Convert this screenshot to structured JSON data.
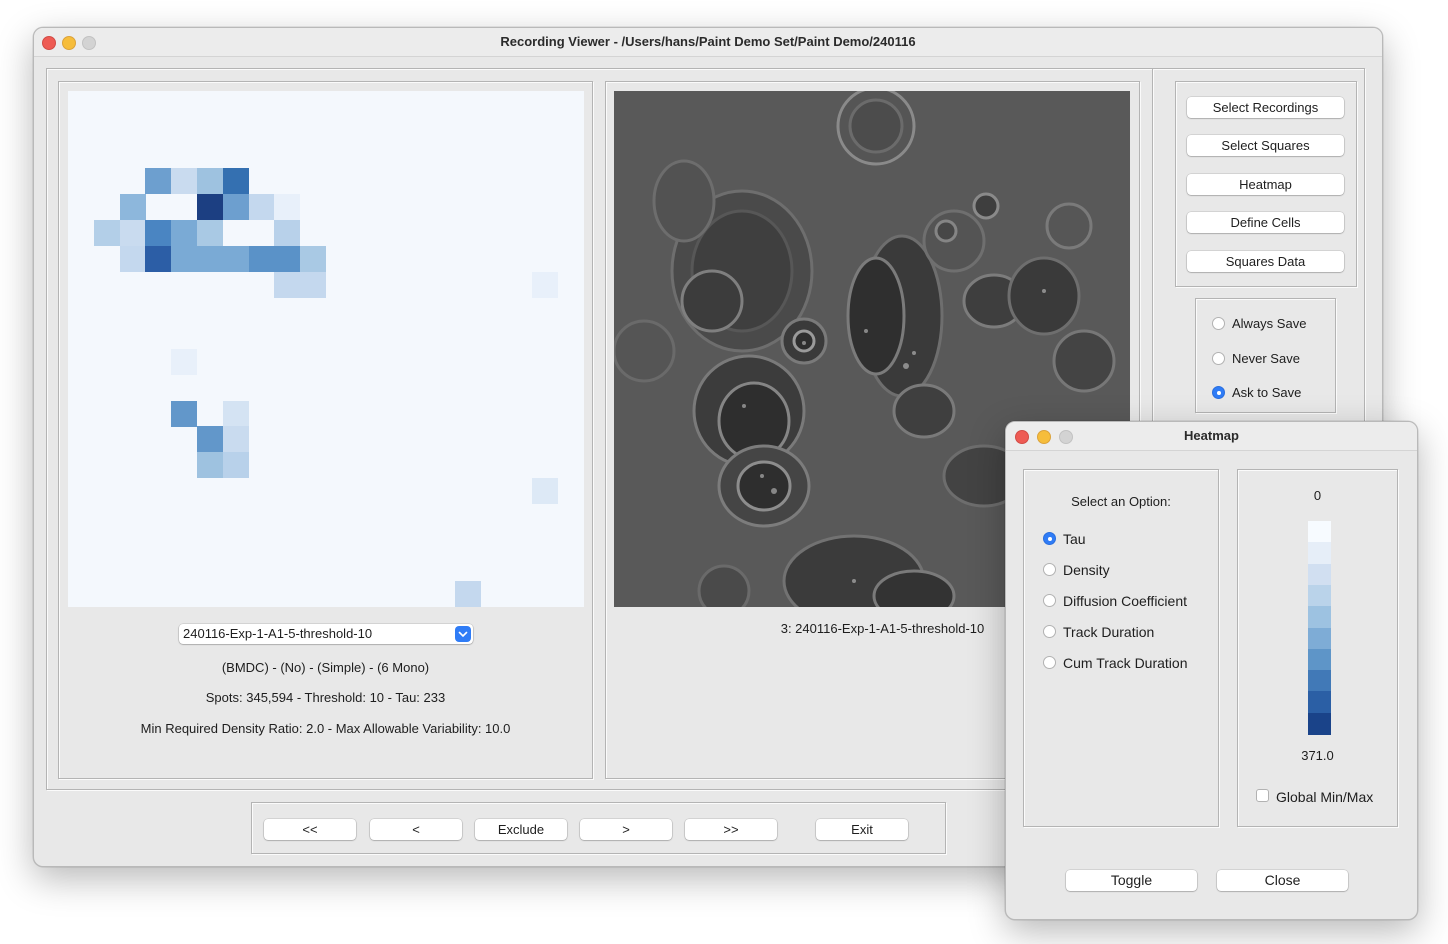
{
  "main_window": {
    "title": "Recording Viewer - /Users/hans/Paint Demo Set/Paint Demo/240116",
    "recording_select": {
      "value": "240116-Exp-1-A1-5-threshold-10"
    },
    "info_line1": "(BMDC) - (No) - (Simple) - (6 Mono)",
    "info_line2": "Spots: 345,594 - Threshold: 10 - Tau: 233",
    "info_line3": "Min Required Density Ratio: 2.0 - Max Allowable Variability: 10.0",
    "image_caption": "3:  240116-Exp-1-A1-5-threshold-10",
    "side_buttons": [
      "Select Recordings",
      "Select Squares",
      "Heatmap",
      "Define Cells",
      "Squares Data"
    ],
    "save_options": [
      {
        "label": "Always Save",
        "selected": false
      },
      {
        "label": "Never Save",
        "selected": false
      },
      {
        "label": "Ask to Save",
        "selected": true
      }
    ],
    "nav_buttons": {
      "first": "<<",
      "prev": "<",
      "exclude": "Exclude",
      "next": ">",
      "last": ">>",
      "exit": "Exit"
    },
    "heatmap_squares": [
      {
        "col": 3,
        "row": 3,
        "color": "#6d9fcf"
      },
      {
        "col": 4,
        "row": 3,
        "color": "#c9dbef"
      },
      {
        "col": 5,
        "row": 3,
        "color": "#9ec2e0"
      },
      {
        "col": 6,
        "row": 3,
        "color": "#3470b1"
      },
      {
        "col": 2,
        "row": 4,
        "color": "#8db7dc"
      },
      {
        "col": 5,
        "row": 4,
        "color": "#1c3f82"
      },
      {
        "col": 6,
        "row": 4,
        "color": "#6d9fcf"
      },
      {
        "col": 7,
        "row": 4,
        "color": "#c4d8ee"
      },
      {
        "col": 8,
        "row": 4,
        "color": "#e8f0fa"
      },
      {
        "col": 1,
        "row": 5,
        "color": "#b3cfe8"
      },
      {
        "col": 2,
        "row": 5,
        "color": "#c9dbef"
      },
      {
        "col": 3,
        "row": 5,
        "color": "#4a85c2"
      },
      {
        "col": 4,
        "row": 5,
        "color": "#7aaad5"
      },
      {
        "col": 5,
        "row": 5,
        "color": "#a9c9e4"
      },
      {
        "col": 8,
        "row": 5,
        "color": "#b8d1ea"
      },
      {
        "col": 2,
        "row": 6,
        "color": "#c4d8ee"
      },
      {
        "col": 3,
        "row": 6,
        "color": "#2c5ea6"
      },
      {
        "col": 4,
        "row": 6,
        "color": "#7aaad5"
      },
      {
        "col": 5,
        "row": 6,
        "color": "#7aaad5"
      },
      {
        "col": 6,
        "row": 6,
        "color": "#7aaad5"
      },
      {
        "col": 7,
        "row": 6,
        "color": "#5a92c8"
      },
      {
        "col": 8,
        "row": 6,
        "color": "#5a92c8"
      },
      {
        "col": 9,
        "row": 6,
        "color": "#a9c9e4"
      },
      {
        "col": 8,
        "row": 7,
        "color": "#c4d8ee"
      },
      {
        "col": 9,
        "row": 7,
        "color": "#c4d8ee"
      },
      {
        "col": 18,
        "row": 7,
        "color": "#e8f0fa"
      },
      {
        "col": 4,
        "row": 10,
        "color": "#e8f0fa"
      },
      {
        "col": 4,
        "row": 12,
        "color": "#6297ca"
      },
      {
        "col": 6,
        "row": 12,
        "color": "#d4e3f3"
      },
      {
        "col": 5,
        "row": 13,
        "color": "#6297ca"
      },
      {
        "col": 6,
        "row": 13,
        "color": "#c9dbef"
      },
      {
        "col": 5,
        "row": 14,
        "color": "#9ec2e0"
      },
      {
        "col": 6,
        "row": 14,
        "color": "#b8d1ea"
      },
      {
        "col": 18,
        "row": 15,
        "color": "#dde9f6"
      },
      {
        "col": 15,
        "row": 19,
        "color": "#c4d8ee"
      }
    ]
  },
  "heatmap_dialog": {
    "title": "Heatmap",
    "select_label": "Select an Option:",
    "options": [
      {
        "label": "Tau",
        "selected": true
      },
      {
        "label": "Density",
        "selected": false
      },
      {
        "label": "Diffusion Coefficient",
        "selected": false
      },
      {
        "label": "Track Duration",
        "selected": false
      },
      {
        "label": "Cum Track Duration",
        "selected": false
      }
    ],
    "legend_min": "0",
    "legend_max": "371.0",
    "legend_colors": [
      "#f7fbff",
      "#e6eef8",
      "#d1dff1",
      "#bad3ea",
      "#9dc2e1",
      "#7eacd6",
      "#5e95c8",
      "#4179b7",
      "#2b5fa5",
      "#1a4389"
    ],
    "global_minmax": {
      "label": "Global Min/Max",
      "checked": false
    },
    "toggle_label": "Toggle",
    "close_label": "Close"
  }
}
